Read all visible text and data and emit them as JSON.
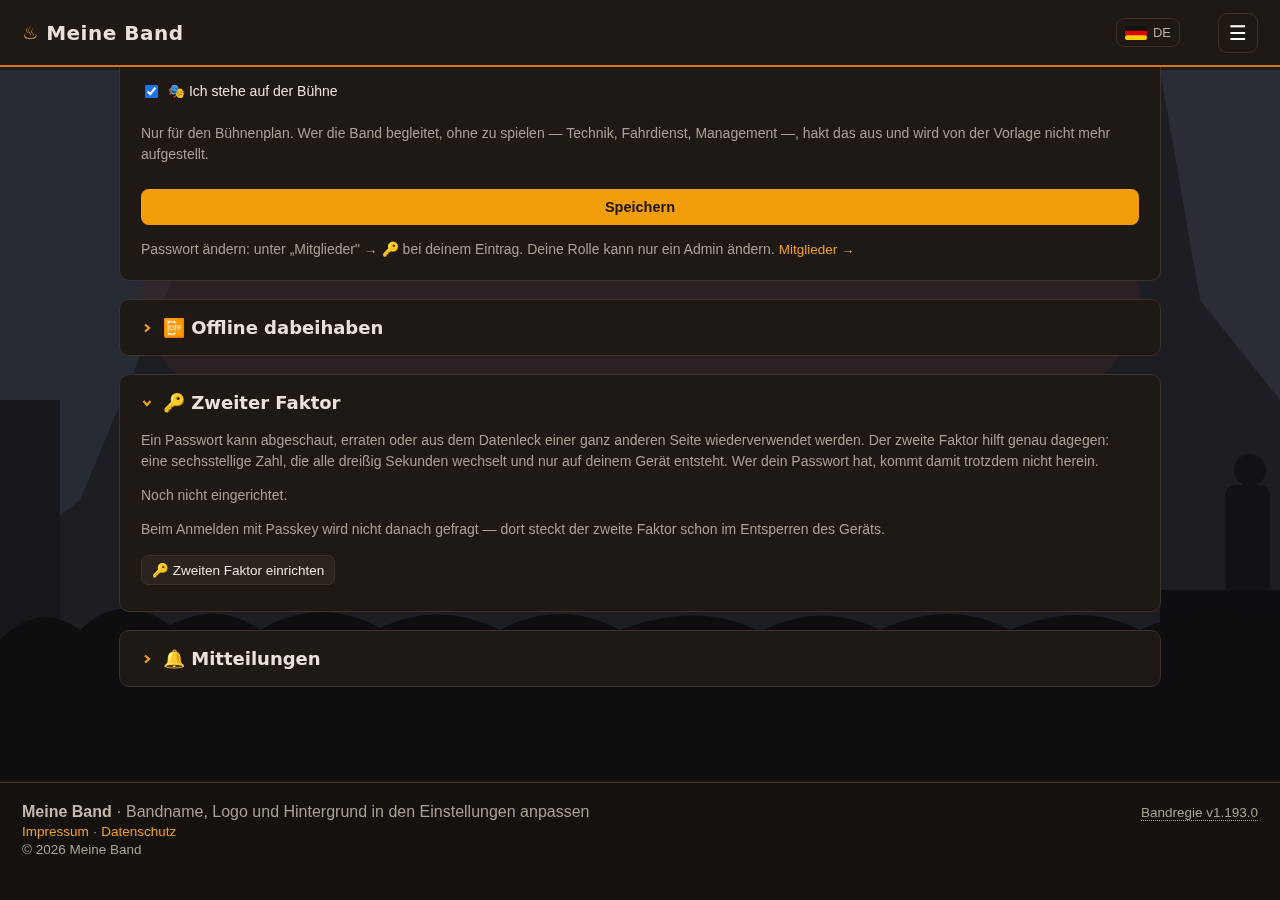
{
  "header": {
    "logo": "♨",
    "title": "Meine Band",
    "language": "DE",
    "menu": "☰"
  },
  "profile_card": {
    "checkbox": {
      "label": "🎭 Ich stehe auf der Bühne",
      "checked": true
    },
    "hint": "Nur für den Bühnenplan. Wer die Band begleitet, ohne zu spielen — Technik, Fahrdienst, Management —, hakt das aus und wird von der Vorlage nicht mehr aufgestellt.",
    "save": "Speichern",
    "note": "Passwort ändern: unter „Mitglieder\" → 🔑 bei deinem Eintrag. Deine Rolle kann nur ein Admin ändern.",
    "link": "Mitglieder →"
  },
  "sections": [
    {
      "title": "📴 Offline dabeihaben",
      "expanded": false
    },
    {
      "title": "🔑 Zweiter Faktor",
      "expanded": true,
      "paragraphs": [
        "Ein Passwort kann abgeschaut, erraten oder aus dem Datenleck einer ganz anderen Seite wiederverwendet werden. Der zweite Faktor hilft genau dagegen: eine sechsstellige Zahl, die alle dreißig Sekunden wechselt und nur auf deinem Gerät entsteht. Wer dein Passwort hat, kommt damit trotzdem nicht herein.",
        "Noch nicht eingerichtet.",
        "Beim Anmelden mit Passkey wird nicht danach gefragt — dort steckt der zweite Faktor schon im Entsperren des Geräts."
      ],
      "button": "🔑 Zweiten Faktor einrichten"
    },
    {
      "title": "🔔 Mitteilungen",
      "expanded": false
    }
  ],
  "footer": {
    "line": "**Meine Band** · Bandname, Logo und Hintergrund in den Einstellungen anpassen",
    "links": [
      "Impressum",
      "Datenschutz"
    ],
    "separator": "·",
    "copyright": "© 2026 Meine Band",
    "version": "Bandregie v1.193.0"
  }
}
